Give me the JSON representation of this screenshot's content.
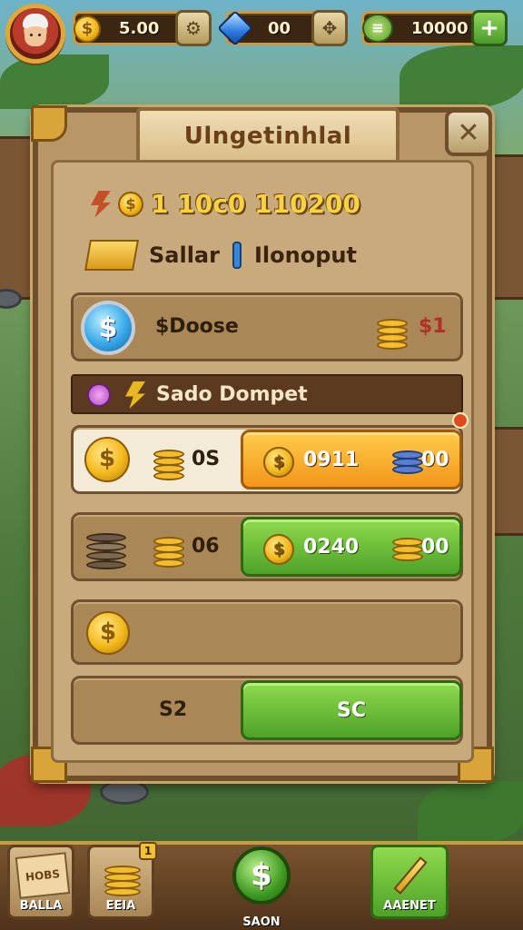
{
  "hud": {
    "coins": "5.00",
    "gems": "00",
    "cash": "10000"
  },
  "dialog": {
    "title": "Ulngetinhlal",
    "stat_line": "1 10c0  110200",
    "subtitle_left": "Sallar",
    "subtitle_right": "Ilonoput",
    "row1": {
      "label": "$Doose",
      "right_value": "$1"
    },
    "band_label": "Sado Dompet",
    "offer1": {
      "left_value": "0S",
      "button_value": "0911",
      "button_extra": "00"
    },
    "offer2": {
      "left_value": "06",
      "button_value": "0240",
      "button_extra": "00"
    },
    "footer": {
      "left_label": "S2",
      "button_label": "SC"
    }
  },
  "bottom_nav": {
    "item1": {
      "label": "BALLA",
      "card_text": "HOBS"
    },
    "item2": {
      "label": "EEIA",
      "badge": "1"
    },
    "center": {
      "label": "SAON"
    },
    "item4": {
      "label": "AAENET"
    }
  },
  "colors": {
    "panel": "#b89668",
    "accent_orange": "#f2961a",
    "accent_green": "#4ea228",
    "coin_gold": "#f3b81c"
  },
  "icons": [
    "avatar",
    "coin-icon",
    "gem-icon",
    "cash-icon",
    "close-icon",
    "bolt-icon",
    "gold-bar-icon",
    "dollar-badge-icon",
    "coin-stack-icon",
    "pencil-icon"
  ]
}
